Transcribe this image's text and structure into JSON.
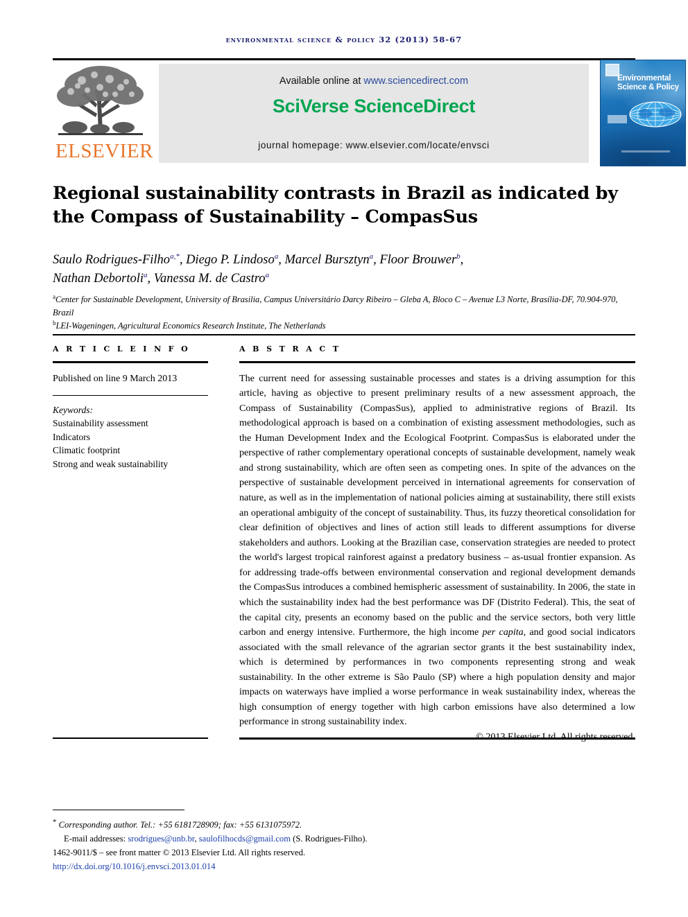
{
  "running_head": "Environmental Science & Policy 32 (2013) 58-67",
  "masthead": {
    "publisher_name": "ELSEVIER",
    "available_prefix": "Available online at ",
    "available_url": "www.sciencedirect.com",
    "brand": "SciVerse ScienceDirect",
    "homepage": "journal homepage: www.elsevier.com/locate/envsci",
    "cover_title": "Environmental Science & Policy"
  },
  "article": {
    "title": "Regional sustainability contrasts in Brazil as indicated by the Compass of Sustainability – CompasSus",
    "authors": [
      {
        "name": "Saulo Rodrigues-Filho",
        "marks": "a,*"
      },
      {
        "name": "Diego P. Lindoso",
        "marks": "a"
      },
      {
        "name": "Marcel Bursztyn",
        "marks": "a"
      },
      {
        "name": "Floor Brouwer",
        "marks": "b"
      },
      {
        "name": "Nathan Debortoli",
        "marks": "a"
      },
      {
        "name": "Vanessa M. de Castro",
        "marks": "a"
      }
    ],
    "affiliations": [
      {
        "mark": "a",
        "text": "Center for Sustainable Development, University of Brasilia, Campus Universitário Darcy Ribeiro – Gleba A, Bloco C – Avenue L3 Norte, Brasília-DF, 70.904-970, Brazil"
      },
      {
        "mark": "b",
        "text": "LEI-Wageningen, Agricultural Economics Research Institute, The Netherlands"
      }
    ]
  },
  "article_info": {
    "heading": "A R T I C L E   I N F O",
    "published": "Published on line 9 March 2013",
    "keywords_label": "Keywords:",
    "keywords": [
      "Sustainability assessment",
      "Indicators",
      "Climatic footprint",
      "Strong and weak sustainability"
    ]
  },
  "abstract": {
    "heading": "A B S T R A C T",
    "paragraph_1": "The current need for assessing sustainable processes and states is a driving assumption for this article, having as objective to present preliminary results of a new assessment approach, the Compass of Sustainability (CompasSus), applied to administrative regions of Brazil. Its methodological approach is based on a combination of existing assessment methodologies, such as the Human Development Index and the Ecological Footprint. CompasSus is elaborated under the perspective of rather complementary operational concepts of sustainable development, namely weak and strong sustainability, which are often seen as competing ones. In spite of the advances on the perspective of sustainable development perceived in international agreements for conservation of nature, as well as in the implementation of national policies aiming at sustainability, there still exists an operational ambiguity of the concept of sustainability. Thus, its fuzzy theoretical consolidation for clear definition of objectives and lines of action still leads to different assumptions for diverse stakeholders and authors. Looking at the Brazilian case, conservation strategies are needed to protect the world's largest tropical rainforest against a predatory business – as-usual frontier expansion. As for addressing trade-offs between environmental conservation and regional development demands the CompasSus introduces a combined hemispheric assessment of sustainability. In 2006, the state in which the sustainability index had the best performance was DF (Distrito Federal). This, the seat of the capital city, presents an economy based on the public and the service sectors, both very little carbon and energy intensive. Furthermore, the high income ",
    "italic_phrase": "per capita",
    "paragraph_2": ", and good social indicators associated with the small relevance of the agrarian sector grants it the best sustainability index, which is determined by performances in two components representing strong and weak sustainability. In the other extreme is São Paulo (SP) where a high population density and major impacts on waterways have implied a worse performance in weak sustainability index, whereas the high consumption of energy together with high carbon emissions have also determined a low performance in strong sustainability index.",
    "copyright": "© 2013 Elsevier Ltd. All rights reserved."
  },
  "footnotes": {
    "corresponding": "Corresponding author. Tel.: +55 6181728909; fax: +55 6131075972.",
    "email_label": "E-mail addresses:",
    "email_1": "srodrigues@unb.br",
    "email_separator": ", ",
    "email_2": "saulofilhocds@gmail.com",
    "email_suffix": " (S. Rodrigues-Filho).",
    "issn_line": "1462-9011/$ – see front matter © 2013 Elsevier Ltd. All rights reserved.",
    "doi": "http://dx.doi.org/10.1016/j.envsci.2013.01.014"
  },
  "colors": {
    "running_head": "#191970",
    "elsevier_orange": "#E8762C",
    "sciverse_green": "#00A550",
    "link_blue": "#2A4B9B",
    "banner_gray": "#E6E6E6",
    "cover_blue": "#1166AE"
  }
}
